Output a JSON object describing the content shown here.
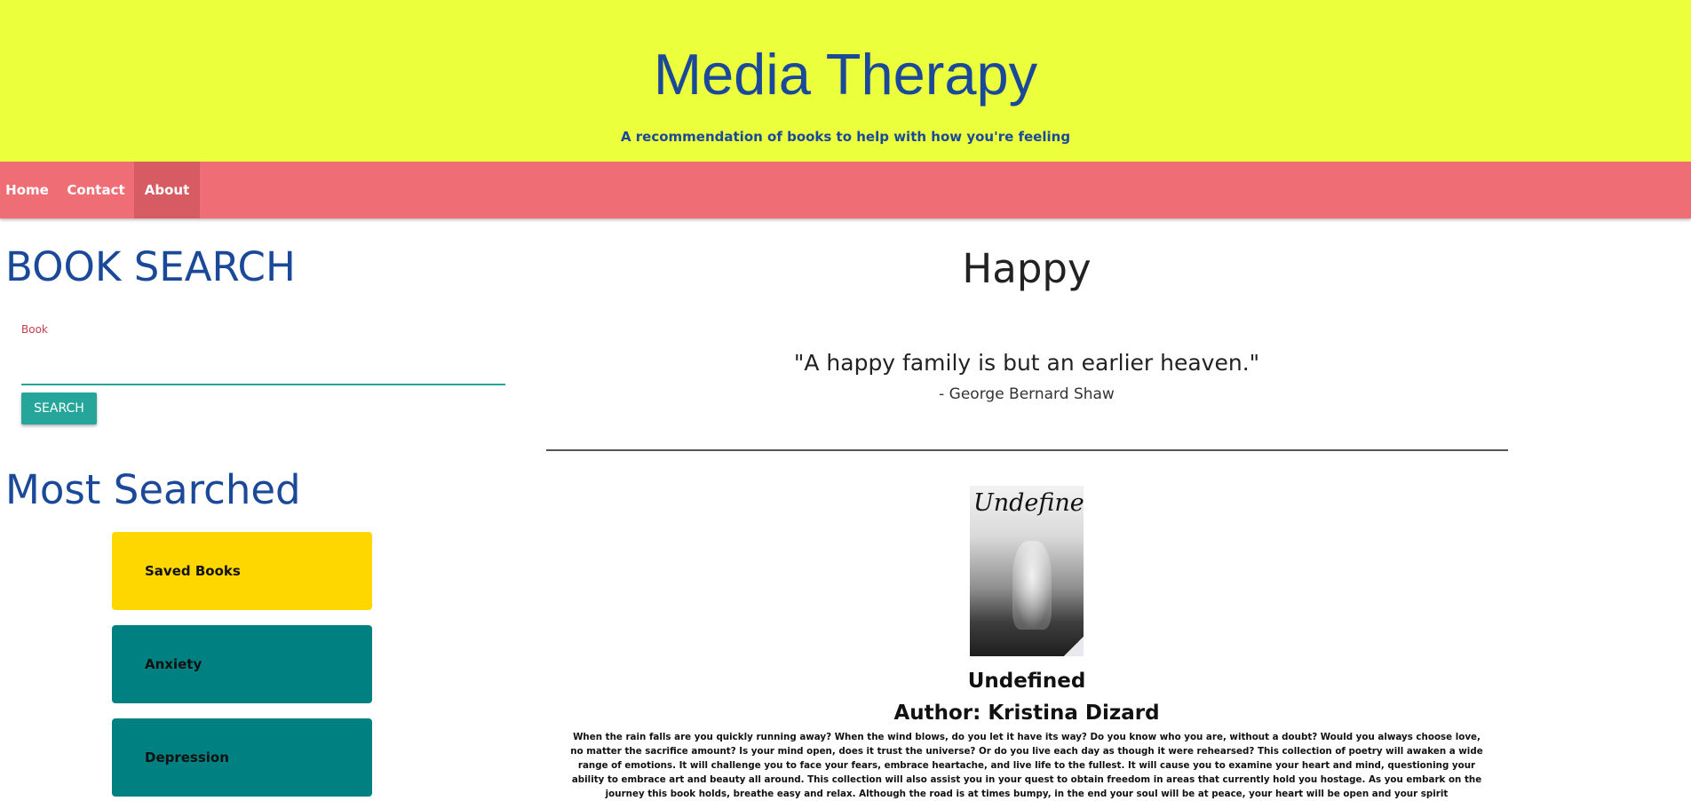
{
  "header": {
    "title": "Media Therapy",
    "subtitle": "A recommendation of books to help with how you're feeling"
  },
  "nav": {
    "items": [
      {
        "label": "Home"
      },
      {
        "label": "Contact"
      },
      {
        "label": "About"
      }
    ],
    "active": "About"
  },
  "search": {
    "heading": "BOOK SEARCH",
    "field_label": "Book",
    "value": "",
    "button_label": "SEARCH"
  },
  "most_searched": {
    "heading": "Most Searched",
    "items": [
      {
        "label": "Saved Books",
        "color": "#ffd700"
      },
      {
        "label": "Anxiety",
        "color": "#008080"
      },
      {
        "label": "Depression",
        "color": "#008080"
      }
    ]
  },
  "mood": {
    "title": "Happy",
    "quote": "\"A happy family is but an earlier heaven.\"",
    "quote_author": "- George Bernard Shaw"
  },
  "book": {
    "cover_title": "Undefined",
    "title": "Undefined",
    "author": "Author: Kristina Dizard",
    "description": "When the rain falls are you quickly running away? When the wind blows, do you let it have its way? Do you know who you are, without a doubt? Would you always choose love, no matter the sacrifice amount? Is your mind open, does it trust the universe? Or do you live each day as though it were rehearsed? This collection of poetry will awaken a wide range of emotions. It will challenge you to face your fears, embrace heartache, and live life to the fullest. It will cause you to examine your heart and mind, questioning your ability to embrace art and beauty all around. This collection will also assist you in your quest to obtain freedom in areas that currently hold you hostage. As you embark on the journey this book holds, breathe easy and relax. Although the road is at times bumpy, in the end your soul will be at peace, your heart will be open and your spirit"
  },
  "colors": {
    "header_bg": "#ecff3d",
    "nav_bg": "#ef6e75",
    "accent_blue": "#1b4999",
    "teal": "#26a69a"
  }
}
